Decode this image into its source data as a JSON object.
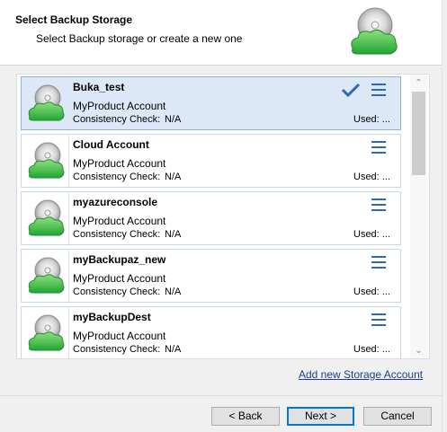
{
  "header": {
    "title": "Select Backup Storage",
    "subtitle": "Select Backup storage or create a new one",
    "logo_icon": "cloud-disc-icon"
  },
  "storage_list": {
    "items": [
      {
        "name": "Buka_test",
        "account": "MyProduct Account",
        "consistency_label": "Consistency Check:",
        "consistency_value": "N/A",
        "used": "Used: ...",
        "selected": true
      },
      {
        "name": "Cloud Account",
        "account": "MyProduct Account",
        "consistency_label": "Consistency Check:",
        "consistency_value": "N/A",
        "used": "Used: ...",
        "selected": false
      },
      {
        "name": "myazureconsole",
        "account": "MyProduct Account",
        "consistency_label": "Consistency Check:",
        "consistency_value": "N/A",
        "used": "Used: ...",
        "selected": false
      },
      {
        "name": "myBackupaz_new",
        "account": "MyProduct Account",
        "consistency_label": "Consistency Check:",
        "consistency_value": "N/A",
        "used": "Used: ...",
        "selected": false
      },
      {
        "name": "myBackupDest",
        "account": "MyProduct Account",
        "consistency_label": "Consistency Check:",
        "consistency_value": "N/A",
        "used": "Used: ...",
        "selected": false
      }
    ]
  },
  "add_link": "Add new Storage Account",
  "buttons": {
    "back": "< Back",
    "next": "Next >",
    "cancel": "Cancel"
  },
  "colors": {
    "selected_bg": "#dce8f8",
    "accent": "#2e66b8",
    "cloud_green": "#3fbf4a"
  }
}
